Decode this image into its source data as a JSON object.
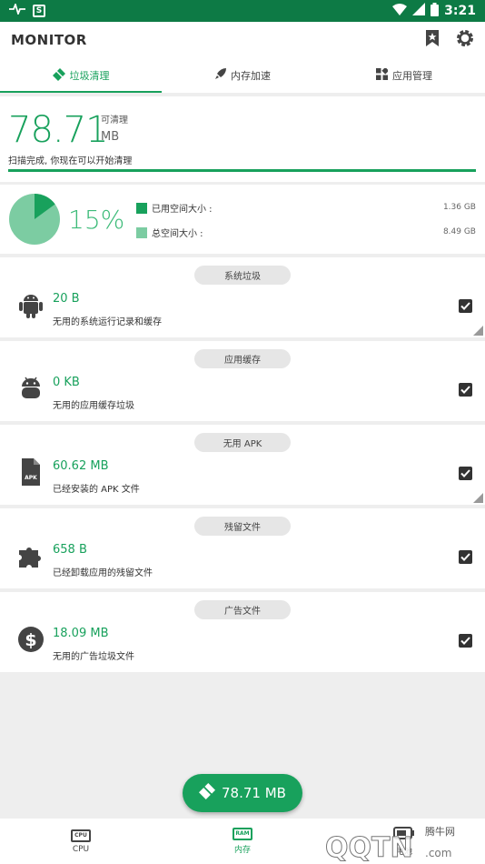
{
  "status_bar": {
    "time": "3:21"
  },
  "app": {
    "title": "MONITOR"
  },
  "tabs": [
    {
      "label": "垃圾清理"
    },
    {
      "label": "内存加速"
    },
    {
      "label": "应用管理"
    }
  ],
  "summary": {
    "amount": "78.71",
    "clean_label": "可清理",
    "unit": "MB",
    "status_text": "扫描完成, 你现在可以开始清理"
  },
  "storage": {
    "percent": "15%",
    "used_fraction": 0.15,
    "used_label": "已用空间大小 :",
    "used_value": "1.36 GB",
    "total_label": "总空间大小 :",
    "total_value": "8.49 GB"
  },
  "junk": [
    {
      "category": "系统垃圾",
      "size": "20 B",
      "desc": "无用的系统运行记录和缓存",
      "icon": "android-icon",
      "checked": true
    },
    {
      "category": "应用缓存",
      "size": "0 KB",
      "desc": "无用的应用缓存垃圾",
      "icon": "android-head-icon",
      "checked": true
    },
    {
      "category": "无用 APK",
      "size": "60.62 MB",
      "desc": "已经安装的 APK 文件",
      "icon": "apk-file-icon",
      "checked": true
    },
    {
      "category": "残留文件",
      "size": "658 B",
      "desc": "已经卸载应用的残留文件",
      "icon": "puzzle-icon",
      "checked": true
    },
    {
      "category": "广告文件",
      "size": "18.09 MB",
      "desc": "无用的广告垃圾文件",
      "icon": "dollar-icon",
      "checked": true
    }
  ],
  "fab": {
    "label": "78.71 MB"
  },
  "bottom_nav": [
    {
      "label": "CPU",
      "chip": "CPU"
    },
    {
      "label": "内存",
      "chip": "RAM"
    },
    {
      "label": "电池"
    }
  ],
  "watermark": {
    "text": "QQTN.com",
    "sub": "腾牛网"
  },
  "colors": {
    "accent": "#18a15c",
    "status_bar": "#0d7a45",
    "pie_light": "#7ccca2"
  }
}
